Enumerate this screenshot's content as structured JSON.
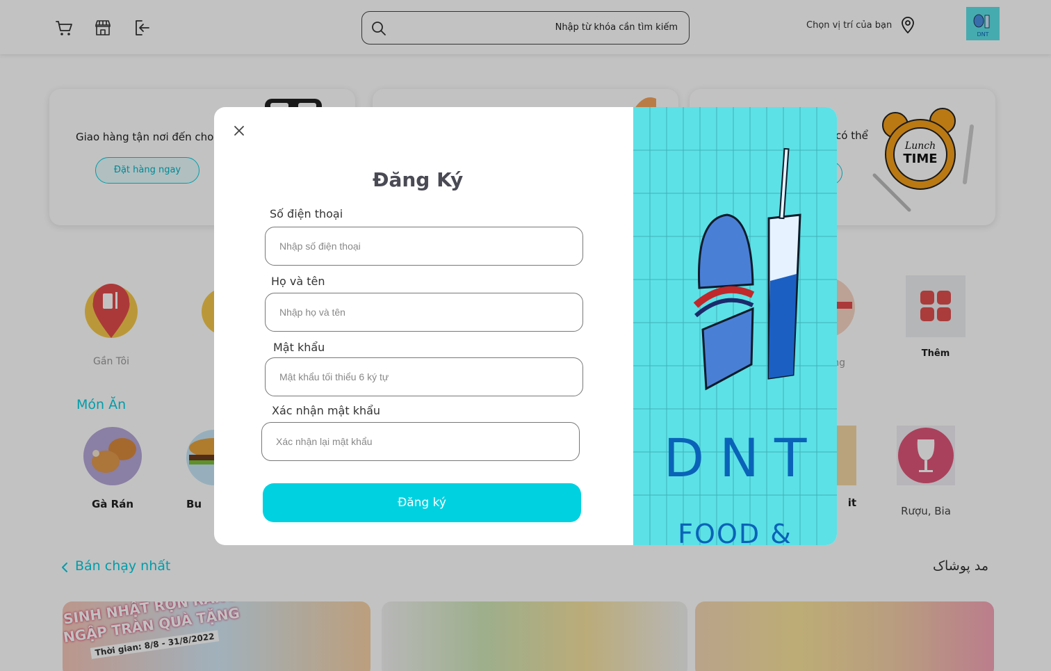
{
  "header": {
    "search_placeholder": "Nhập từ khóa cần tìm kiếm",
    "location_label": "Chọn vị trí của bạn",
    "icons": [
      "cart-icon",
      "store-icon",
      "logout-icon",
      "search-icon",
      "location-pin-icon"
    ],
    "logo_text": "DNT"
  },
  "promos": [
    {
      "text": "Giao hàng tận nơi đến cho bạ",
      "button": "Đặt hàng ngay"
    },
    {
      "text": ""
    },
    {
      "text": "có thể",
      "image_text": [
        "Lunch",
        "TIME"
      ]
    }
  ],
  "categories_top": [
    {
      "label": "Gần Tôi"
    },
    {
      "label": "ng"
    },
    {
      "label": "Thêm"
    }
  ],
  "food_section": {
    "title": "Món Ăn",
    "items": [
      {
        "label": "Gà Rán"
      },
      {
        "label": "Bu"
      },
      {
        "label": "it"
      },
      {
        "label": "Rượu, Bia"
      }
    ]
  },
  "bestseller": {
    "title": "Bán chạy nhất",
    "rtl_title": "مد پوشاک",
    "banner1_text": [
      "SINH NHẬT RỘN RÀNG",
      "NGẬP TRÀN QUÀ TẶNG",
      "Thời gian: 8/8 - 31/8/2022"
    ]
  },
  "modal": {
    "title": "Đăng Ký",
    "fields": [
      {
        "label": "Số điện thoại",
        "placeholder": "Nhập số điện thoại"
      },
      {
        "label": "Họ và tên",
        "placeholder": "Nhập họ và tên"
      },
      {
        "label": "Mật khẩu",
        "placeholder": "Mật khẩu tối thiểu 6 ký tự"
      },
      {
        "label": "Xác nhận mật khẩu",
        "placeholder": "Xác nhận lại mật khẩu"
      }
    ],
    "submit_label": "Đăng ký",
    "brand": {
      "name": "DNT",
      "tagline": "FOOD & DRINK"
    }
  },
  "colors": {
    "accent": "#00d1e0",
    "brand_bg": "#5ce1e6",
    "brand_text": "#0a63b8",
    "overlay": "rgba(0,0,0,0.24)"
  }
}
